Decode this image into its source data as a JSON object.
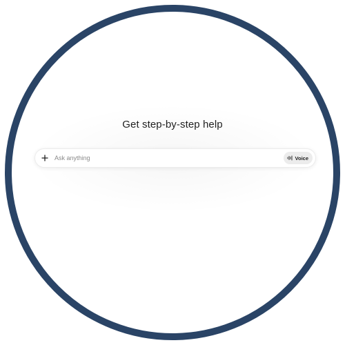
{
  "main": {
    "heading": "Get step-by-step help"
  },
  "composer": {
    "placeholder": "Ask anything",
    "value": "",
    "add_icon": "plus-icon",
    "voice_icon": "waveform-icon",
    "voice_label": "Voice"
  },
  "colors": {
    "ring": "#2a4466",
    "voice_button_bg": "#ececec",
    "heading_text": "#1f1f1f",
    "placeholder_text": "#8a8a8a"
  }
}
